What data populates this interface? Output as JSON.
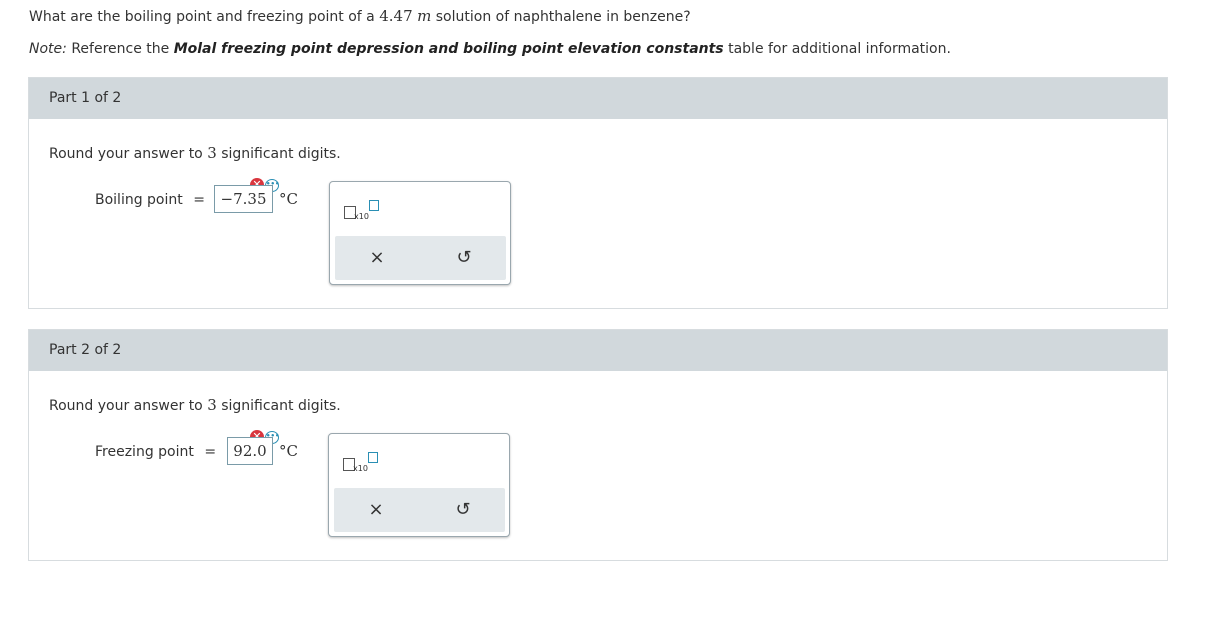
{
  "question": {
    "prefix": "What are the boiling point and freezing point of a",
    "molality_value": "4.47",
    "molality_unit": "m",
    "suffix": "solution of naphthalene in benzene?"
  },
  "note": {
    "label": "Note:",
    "prefix": "Reference the",
    "table_name": "Molal freezing point depression and boiling point elevation constants",
    "suffix": "table for additional information."
  },
  "parts": [
    {
      "header": "Part 1 of 2",
      "instruction_prefix": "Round your answer to",
      "digits": "3",
      "instruction_suffix": "significant digits.",
      "field_label": "Boiling point",
      "equals": "=",
      "answer": "−7.35",
      "unit": "°C",
      "error_icon": "x-circle-icon",
      "x10_label": "x10",
      "clear_symbol": "×",
      "undo_symbol": "↺"
    },
    {
      "header": "Part 2 of 2",
      "instruction_prefix": "Round your answer to",
      "digits": "3",
      "instruction_suffix": "significant digits.",
      "field_label": "Freezing point",
      "equals": "=",
      "answer": "92.0",
      "unit": "°C",
      "error_icon": "x-circle-icon",
      "x10_label": "x10",
      "clear_symbol": "×",
      "undo_symbol": "↺"
    }
  ],
  "colors": {
    "header_bg": "#d1d8dc",
    "error": "#d9363e",
    "accent": "#2a8fb4"
  }
}
